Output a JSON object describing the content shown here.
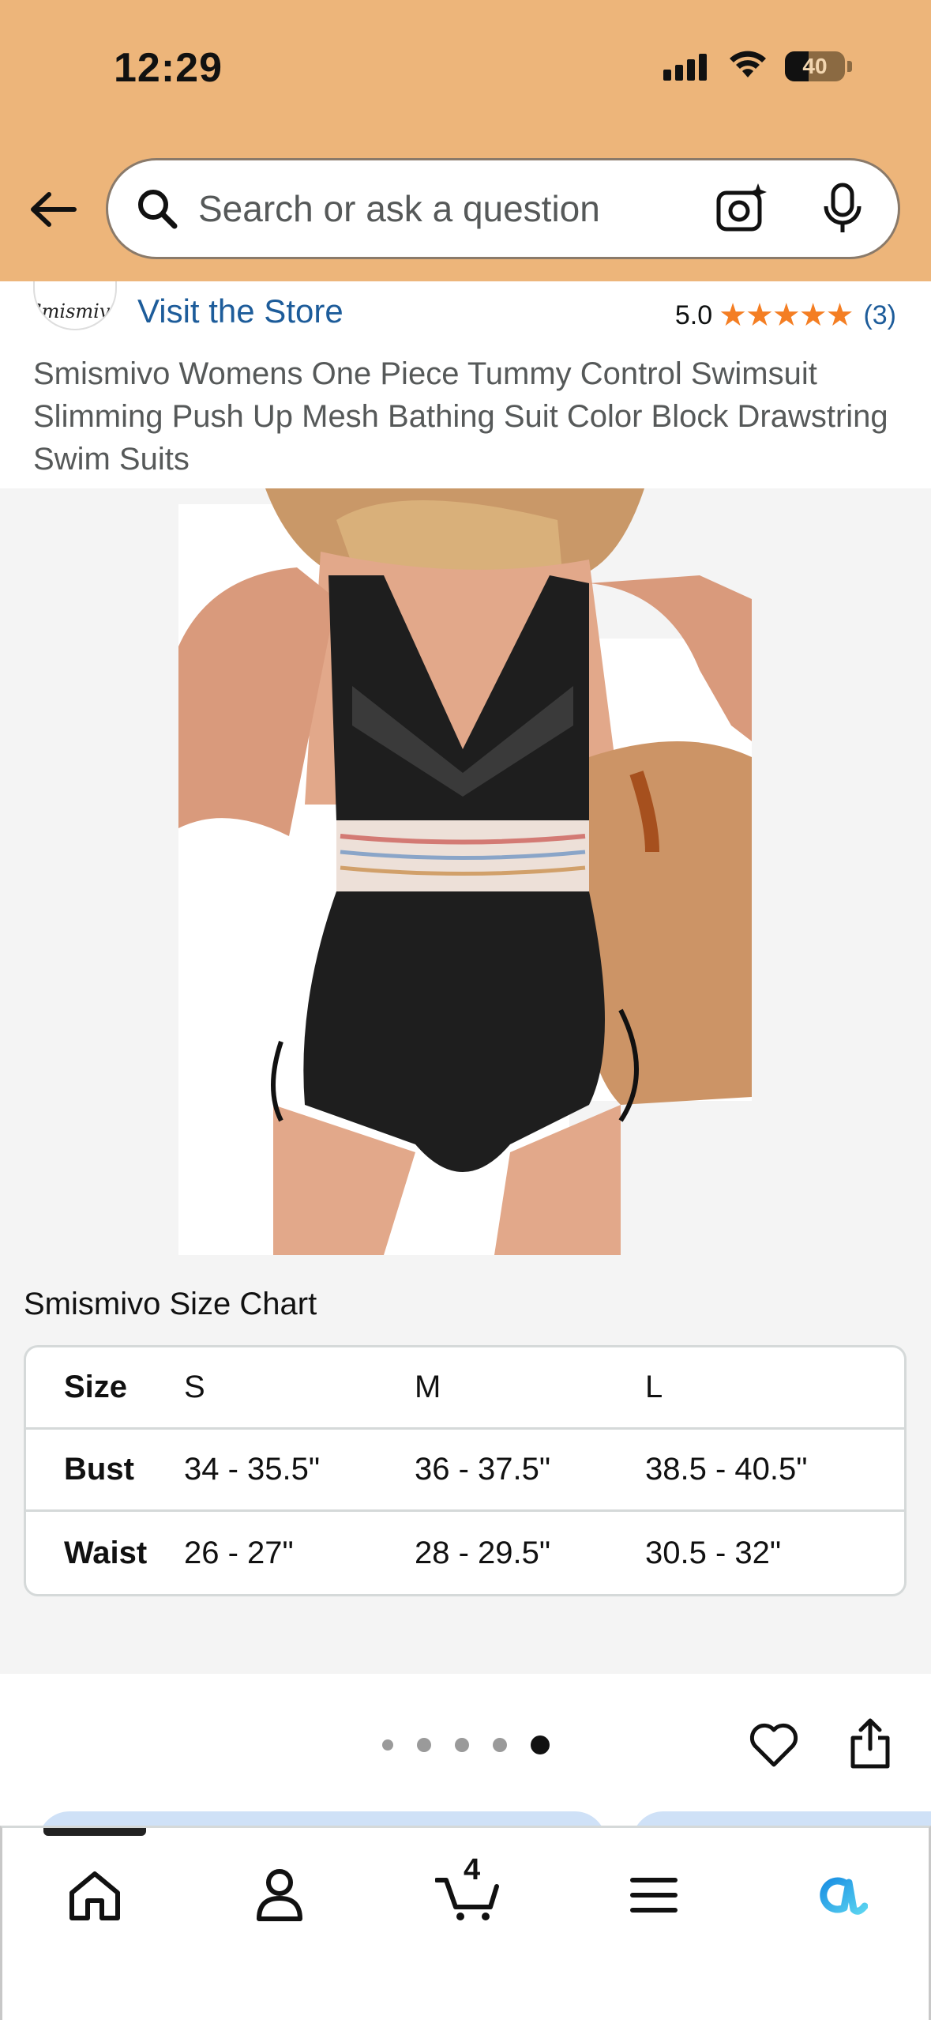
{
  "status_bar": {
    "time": "12:29",
    "battery": "40"
  },
  "search": {
    "placeholder": "Search or ask a question"
  },
  "store": {
    "logo_text": "Smismivo",
    "visit_label": "Visit the Store",
    "rating_value": "5.0",
    "stars": "★★★★★",
    "rating_count": "(3)"
  },
  "product": {
    "title": "Smismivo Womens One Piece Tummy Control Swimsuit Slimming Push Up Mesh Bathing Suit Color Block Drawstring Swim Suits"
  },
  "size_chart": {
    "title": "Smismivo Size Chart",
    "rows": [
      [
        "Size",
        "S",
        "M",
        "L"
      ],
      [
        "Bust",
        "34 - 35.5\"",
        "36 - 37.5\"",
        "38.5 - 40.5\""
      ],
      [
        "Waist",
        "26 - 27\"",
        "28 - 29.5\"",
        "30.5 - 32\""
      ]
    ]
  },
  "gallery": {
    "image_count": 5,
    "active_index": 4
  },
  "bottom_nav": {
    "cart_count": "4",
    "items": [
      "home-icon",
      "account-icon",
      "cart-icon",
      "menu-icon",
      "rufus-icon"
    ]
  },
  "colors": {
    "header_bg": "#edb57a",
    "link": "#1d5c9a",
    "star": "#f47e23",
    "gallery_bg": "#f4f4f4"
  }
}
